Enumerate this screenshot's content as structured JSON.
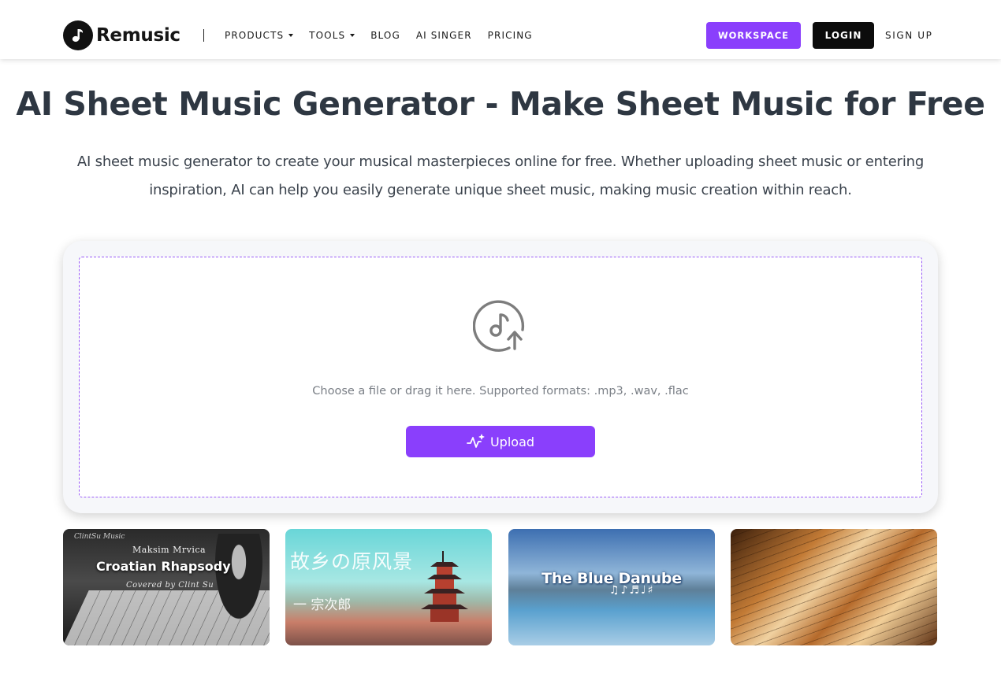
{
  "brand": {
    "name": "Remusic",
    "logo_icon": "music-note-icon"
  },
  "nav": {
    "items": [
      {
        "label": "PRODUCTS",
        "dropdown": true
      },
      {
        "label": "TOOLS",
        "dropdown": true
      },
      {
        "label": "BLOG",
        "dropdown": false
      },
      {
        "label": "AI SINGER",
        "dropdown": false
      },
      {
        "label": "PRICING",
        "dropdown": false
      }
    ],
    "workspace_label": "WORKSPACE",
    "login_label": "LOGIN",
    "signup_label": "SIGN UP"
  },
  "hero": {
    "title": "AI Sheet Music Generator - Make Sheet Music for Free",
    "description": "AI sheet music generator to create your musical masterpieces online for free. Whether uploading sheet music or entering inspiration, AI can help you easily generate unique sheet music, making music creation within reach."
  },
  "upload": {
    "icon": "music-upload-icon",
    "hint": "Choose a file or drag it here. Supported formats: .mp3, .wav, .flac",
    "button_label": "Upload",
    "button_icon": "sparkle-wave-icon"
  },
  "gallery": [
    {
      "brand": "ClintSu Music",
      "author": "Maksim Mrvica",
      "title": "Croatian Rhapsody",
      "subtitle": "Covered by Clint Su"
    },
    {
      "title": "故乡の原风景",
      "subtitle": "一 宗次郎"
    },
    {
      "title": "The Blue Danube",
      "notes": "♫♪♬♩♯"
    },
    {
      "title": ""
    }
  ],
  "colors": {
    "accent": "#8a3ffc",
    "dark": "#0c0c0c",
    "text": "#2e3742",
    "dashed_border": "#9a5cf7"
  }
}
